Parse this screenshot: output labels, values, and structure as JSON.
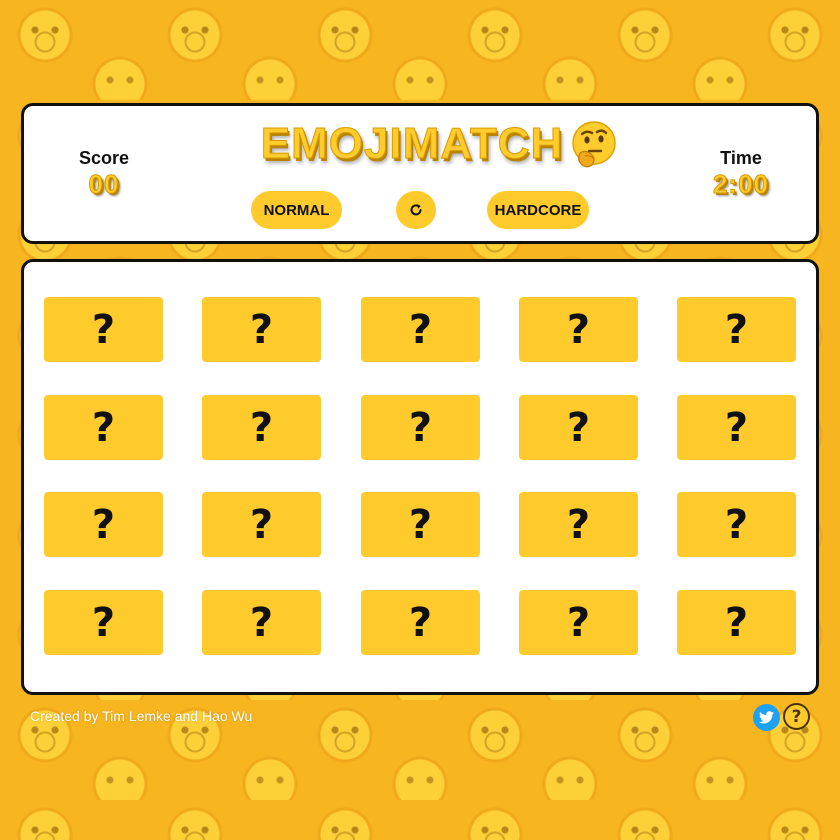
{
  "header": {
    "title": "EMOJIMATCH",
    "title_emoji": "thinking-face",
    "score": {
      "label": "Score",
      "value": "00"
    },
    "time": {
      "label": "Time",
      "value": "2:00"
    },
    "buttons": {
      "normal": "NORMAL",
      "reset_icon": "refresh-icon",
      "hardcore": "HARDCORE"
    }
  },
  "board": {
    "rows": 4,
    "columns": 5,
    "cards": [
      "?",
      "?",
      "?",
      "?",
      "?",
      "?",
      "?",
      "?",
      "?",
      "?",
      "?",
      "?",
      "?",
      "?",
      "?",
      "?",
      "?",
      "?",
      "?",
      "?"
    ]
  },
  "footer": {
    "credit": "Created by Tim Lemke and Hao Wu",
    "twitter_icon": "twitter-icon",
    "help_label": "?"
  },
  "colors": {
    "background": "#f7b51f",
    "accent_yellow": "#ffcb2c",
    "panel": "#ffffff",
    "border": "#111111",
    "twitter_blue": "#1da1f2"
  }
}
